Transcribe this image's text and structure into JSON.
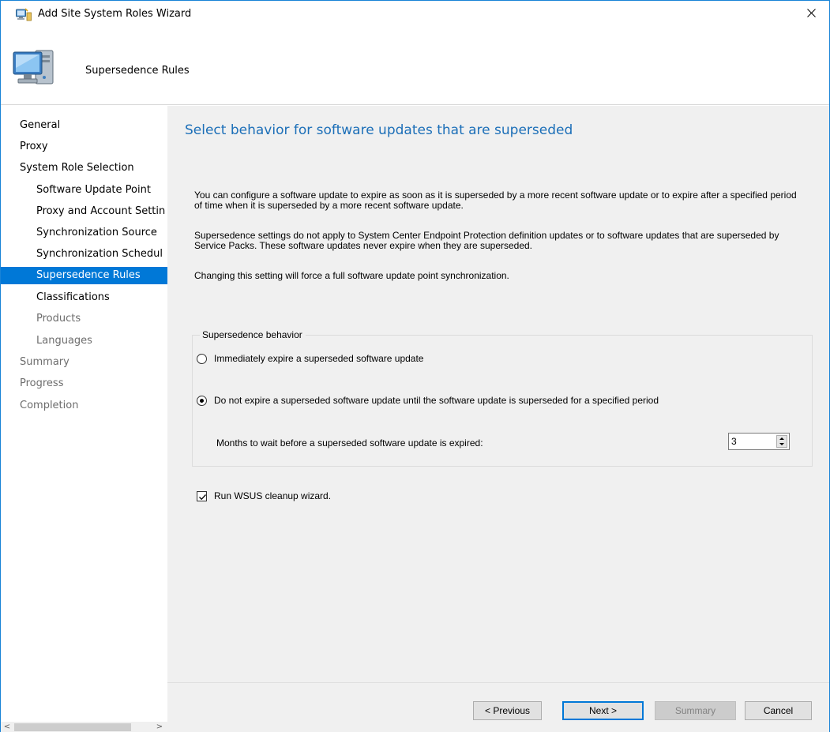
{
  "window": {
    "title": "Add Site System Roles Wizard"
  },
  "header": {
    "title": "Supersedence Rules"
  },
  "nav": {
    "items": [
      {
        "label": "General",
        "level": 0,
        "state": "normal"
      },
      {
        "label": "Proxy",
        "level": 0,
        "state": "normal"
      },
      {
        "label": "System Role Selection",
        "level": 0,
        "state": "normal"
      },
      {
        "label": "Software Update Point",
        "level": 1,
        "state": "normal"
      },
      {
        "label": "Proxy and Account Settin",
        "level": 1,
        "state": "normal"
      },
      {
        "label": "Synchronization Source",
        "level": 1,
        "state": "normal"
      },
      {
        "label": "Synchronization Schedul",
        "level": 1,
        "state": "normal"
      },
      {
        "label": "Supersedence Rules",
        "level": 1,
        "state": "selected"
      },
      {
        "label": "Classifications",
        "level": 1,
        "state": "normal"
      },
      {
        "label": "Products",
        "level": 1,
        "state": "disabled"
      },
      {
        "label": "Languages",
        "level": 1,
        "state": "disabled"
      },
      {
        "label": "Summary",
        "level": 0,
        "state": "disabled"
      },
      {
        "label": "Progress",
        "level": 0,
        "state": "disabled"
      },
      {
        "label": "Completion",
        "level": 0,
        "state": "disabled"
      }
    ],
    "scroll_left": "<",
    "scroll_right": ">"
  },
  "content": {
    "title": "Select behavior for software updates that are superseded",
    "paragraph1": "You can configure a software update to expire as soon as it is superseded by a more recent software update or to expire after a specified period of time when it is superseded by a more recent software update.",
    "paragraph2": "Supersedence settings do not apply to System Center Endpoint Protection definition updates or to software updates that are superseded by Service Packs. These software updates never expire when they are superseded.",
    "paragraph3": "Changing this setting will force a full software update point synchronization.",
    "group": {
      "legend": "Supersedence behavior",
      "option_immediate": "Immediately expire a superseded software update",
      "option_delay": "Do not expire a superseded software update until the software update is superseded for a specified period",
      "selected": "option_delay",
      "months_label": "Months to wait before a superseded software update is expired:",
      "months_value": "3"
    },
    "cleanup_label": "Run WSUS cleanup wizard.",
    "cleanup_checked": true
  },
  "footer": {
    "previous": "< Previous",
    "next": "Next >",
    "summary": "Summary",
    "cancel": "Cancel"
  },
  "colors": {
    "selection": "#0078d7",
    "title_blue": "#1c6fb8",
    "panel": "#f0f0f0"
  }
}
